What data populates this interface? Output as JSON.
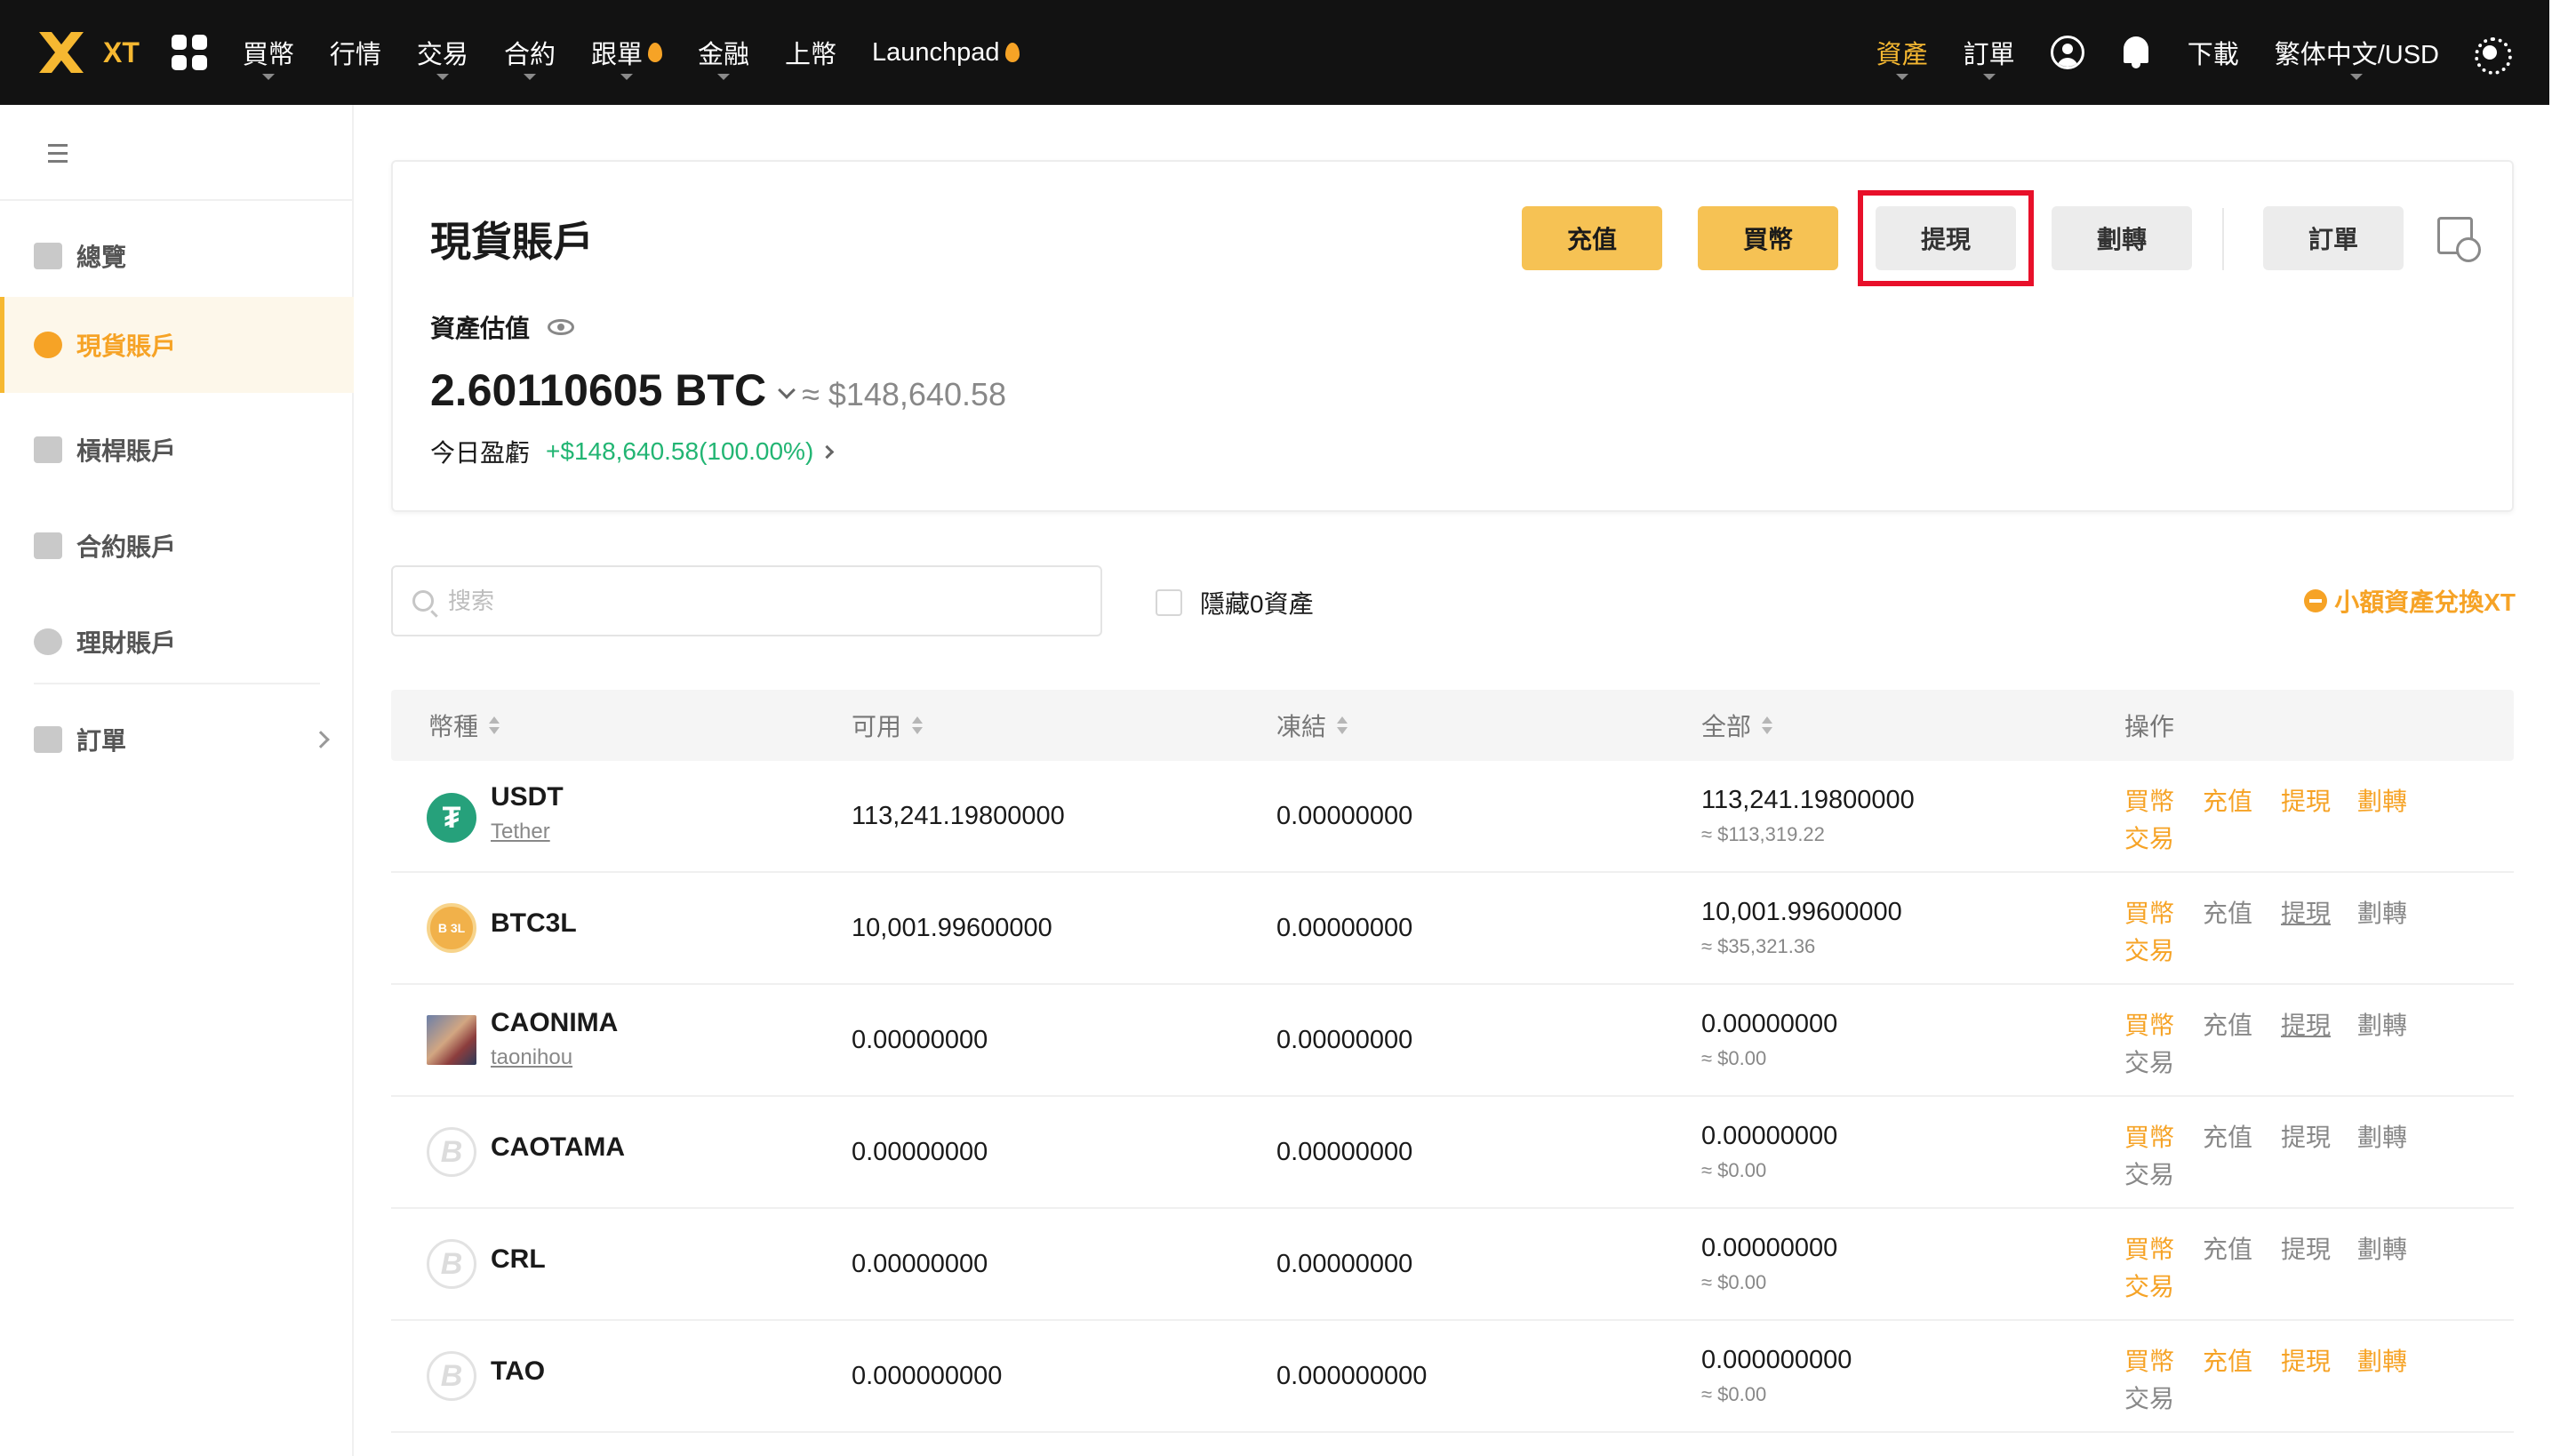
{
  "colors": {
    "accent": "#f6b831",
    "profit": "#22b573",
    "highlight": "#e8102a",
    "nav_bg": "#121212"
  },
  "brand": {
    "logo_text": "XT"
  },
  "nav": {
    "left": [
      "買幣",
      "行情",
      "交易",
      "合約",
      "跟單",
      "金融",
      "上幣",
      "Launchpad"
    ],
    "right": {
      "assets": "資產",
      "orders": "訂單",
      "download": "下載",
      "language": "繁体中文/USD"
    }
  },
  "sidebar": {
    "items": [
      {
        "label": "總覽",
        "icon": "wallet-icon"
      },
      {
        "label": "現貨賬戶",
        "icon": "pie-chart-icon"
      },
      {
        "label": "槓桿賬戶",
        "icon": "sliders-icon"
      },
      {
        "label": "合約賬戶",
        "icon": "contract-icon"
      },
      {
        "label": "理財賬戶",
        "icon": "finance-icon"
      },
      {
        "label": "訂單",
        "icon": "order-list-icon"
      }
    ]
  },
  "account": {
    "title": "現貨賬戶",
    "buttons": {
      "deposit": "充值",
      "buy": "買幣",
      "withdraw": "提現",
      "transfer": "劃轉",
      "orders": "訂單"
    },
    "estimate_label": "資產估值",
    "balance_btc": "2.60110605 BTC",
    "balance_usd": "≈ $148,640.58",
    "pnl_label": "今日盈虧",
    "pnl_value": "+$148,640.58(100.00%)"
  },
  "filters": {
    "search_placeholder": "搜索",
    "hide_zero": "隱藏0資產",
    "small_convert": "小額資產兌換XT"
  },
  "table": {
    "headers": [
      "幣種",
      "可用",
      "凍結",
      "全部",
      "操作"
    ],
    "actions": [
      "買幣",
      "充值",
      "提現",
      "劃轉",
      "交易"
    ],
    "rows": [
      {
        "coin": "USDT",
        "fullname": "Tether",
        "available": "113,241.19800000",
        "frozen": "0.00000000",
        "total": "113,241.19800000",
        "total_usd": "≈ $113,319.22",
        "icon": "tether-icon"
      },
      {
        "coin": "BTC3L",
        "fullname": "",
        "available": "10,001.99600000",
        "frozen": "0.00000000",
        "total": "10,001.99600000",
        "total_usd": "≈ $35,321.36",
        "icon": "btc3l-icon"
      },
      {
        "coin": "CAONIMA",
        "fullname": "taonihou",
        "available": "0.00000000",
        "frozen": "0.00000000",
        "total": "0.00000000",
        "total_usd": "≈ $0.00",
        "icon": "caonima-icon"
      },
      {
        "coin": "CAOTAMA",
        "fullname": "",
        "available": "0.00000000",
        "frozen": "0.00000000",
        "total": "0.00000000",
        "total_usd": "≈ $0.00",
        "icon": "generic-coin-icon"
      },
      {
        "coin": "CRL",
        "fullname": "",
        "available": "0.00000000",
        "frozen": "0.00000000",
        "total": "0.00000000",
        "total_usd": "≈ $0.00",
        "icon": "generic-coin-icon"
      },
      {
        "coin": "TAO",
        "fullname": "",
        "available": "0.000000000",
        "frozen": "0.000000000",
        "total": "0.000000000",
        "total_usd": "≈ $0.00",
        "icon": "generic-coin-icon"
      }
    ]
  }
}
